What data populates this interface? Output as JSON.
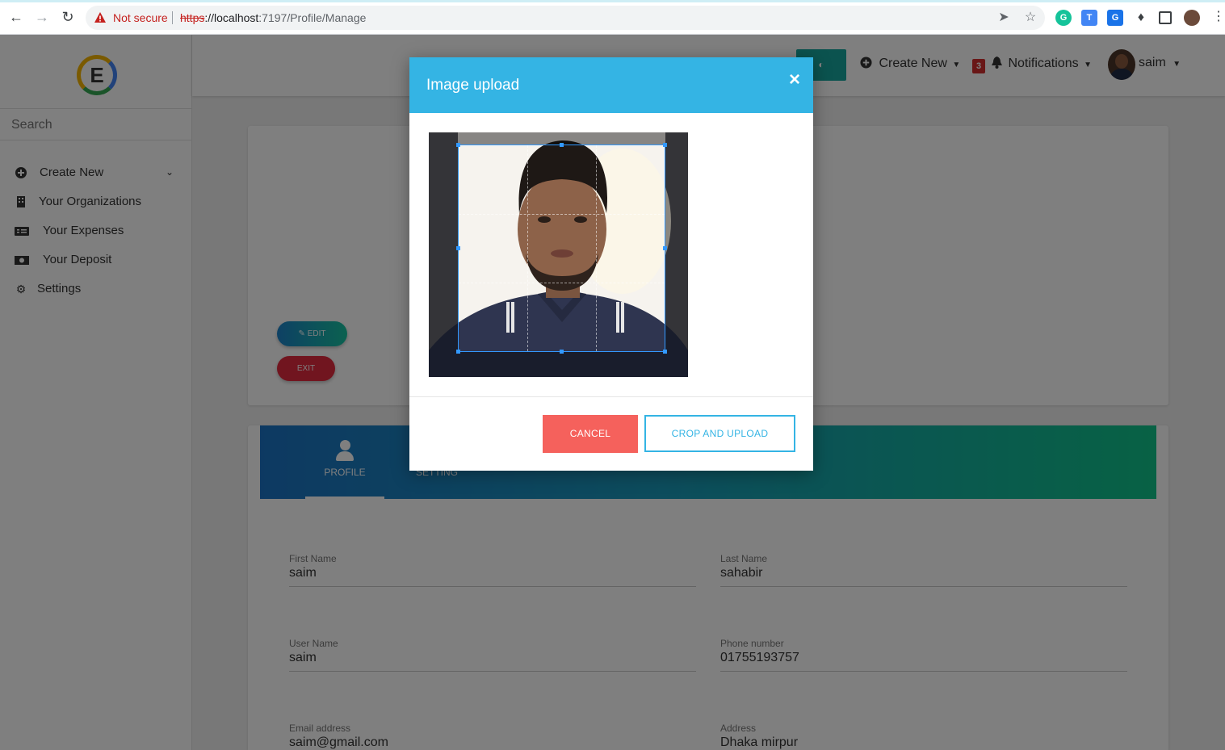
{
  "browser": {
    "security_text": "Not secure",
    "url_scheme": "https",
    "url_host": "://localhost",
    "url_rest": ":7197/Profile/Manage"
  },
  "sidebar": {
    "logo_letter": "E",
    "search_placeholder": "Search",
    "items": [
      {
        "label": "Create New",
        "icon": "plus-circle-icon"
      },
      {
        "label": "Your Organizations",
        "icon": "building-icon"
      },
      {
        "label": "Your Expenses",
        "icon": "receipt-icon"
      },
      {
        "label": "Your Deposit",
        "icon": "money-bill-icon"
      },
      {
        "label": "Settings",
        "icon": "gear-icon"
      }
    ]
  },
  "topbar": {
    "create_new": "Create New",
    "notification_count": "3",
    "notifications": "Notifications",
    "user_name": "saim"
  },
  "profile_card": {
    "edit_label": "EDIT",
    "exit_label": "EXIT"
  },
  "tabs": [
    {
      "label": "PROFILE",
      "active": true
    },
    {
      "label": "SETTING",
      "active": false
    }
  ],
  "form": {
    "first_name": {
      "label": "First Name",
      "value": "saim"
    },
    "last_name": {
      "label": "Last Name",
      "value": "sahabir"
    },
    "user_name": {
      "label": "User Name",
      "value": "saim"
    },
    "phone": {
      "label": "Phone number",
      "value": "01755193757"
    },
    "email": {
      "label": "Email address",
      "value": "saim@gmail.com"
    },
    "address": {
      "label": "Address",
      "value": "Dhaka mirpur"
    }
  },
  "modal": {
    "title": "Image upload",
    "close_glyph": "×",
    "cancel_label": "CANCEL",
    "crop_label": "CROP AND UPLOAD"
  },
  "colors": {
    "modal_header": "#34b4e4",
    "cancel": "#f5615c",
    "accent_gradient_start": "#1b73c4",
    "accent_gradient_end": "#10c48a"
  }
}
